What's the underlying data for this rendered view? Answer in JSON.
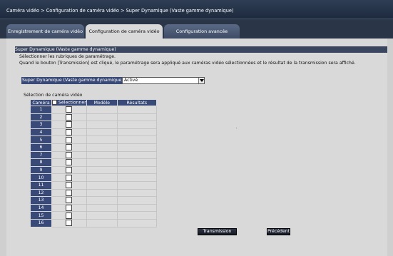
{
  "breadcrumb": "Caméra vidéo > Configuration de caméra vidéo > Super Dynamique (Vaste gamme dynamique)",
  "tabs": [
    {
      "label": "Enregistrement de caméra vidéo"
    },
    {
      "label": "Configuration de caméra vidéo"
    },
    {
      "label": "Configuration avancée"
    }
  ],
  "section_title": "Super Dynamique (Vaste gamme dynamique)",
  "description": [
    "Sélectionner les rubriques de paramétrage.",
    "Quand le bouton [Transmission] est cliqué, le paramétrage sera appliqué aux caméras vidéo sélectionnées et le résultat de la transmission sera affiché."
  ],
  "param": {
    "label": "Super Dynamique (Vaste gamme dynamique)",
    "value": "Activé"
  },
  "camera_selection_label": "Sélection de caméra vidéo",
  "table": {
    "headers": {
      "camera": "Caméra",
      "select": "Sélectionner",
      "model": "Modèle",
      "results": "Résultats"
    },
    "rows": [
      "1",
      "2",
      "3",
      "4",
      "5",
      "6",
      "7",
      "8",
      "9",
      "10",
      "11",
      "12",
      "13",
      "14",
      "15",
      "16"
    ]
  },
  "buttons": {
    "transmit": "Transmission",
    "previous": "Précédent"
  },
  "colors": {
    "header_bar": "#1d2a3e",
    "table_header": "#3a4a78",
    "content_bg": "#d9d9d9"
  }
}
